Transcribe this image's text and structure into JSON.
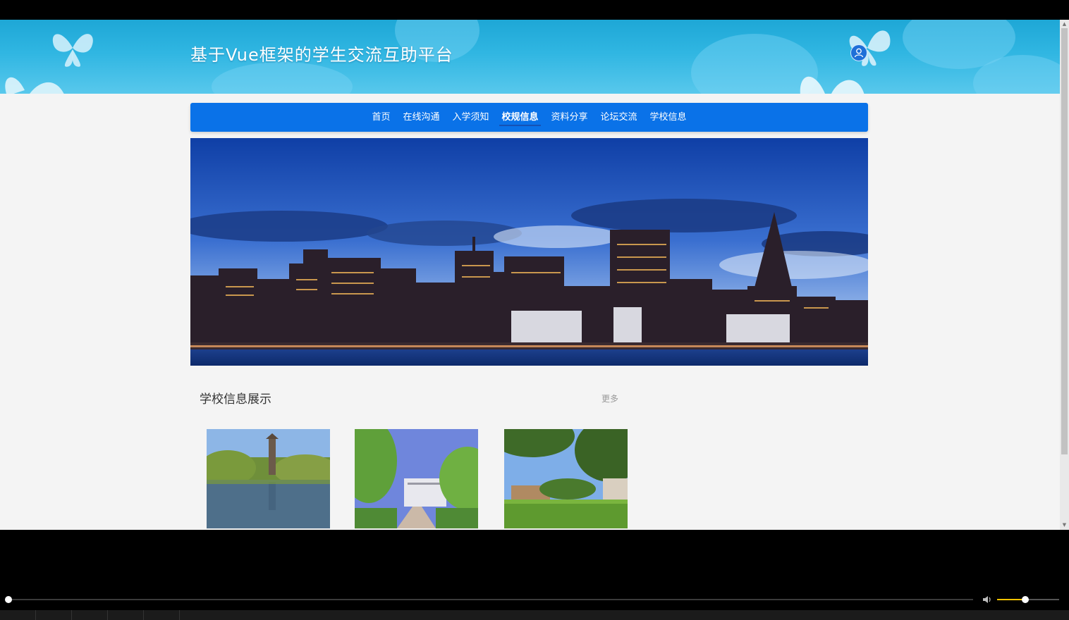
{
  "header": {
    "site_title": "基于Vue框架的学生交流互助平台"
  },
  "nav": {
    "items": [
      {
        "label": "首页"
      },
      {
        "label": "在线沟通"
      },
      {
        "label": "入学须知"
      },
      {
        "label": "校规信息"
      },
      {
        "label": "资料分享"
      },
      {
        "label": "论坛交流"
      },
      {
        "label": "学校信息"
      }
    ],
    "active_index": 3
  },
  "section": {
    "title": "学校信息展示",
    "more_label": "更多"
  },
  "player": {
    "progress": 0.0,
    "volume": 0.45
  },
  "colors": {
    "header_bg": "#30b6e2",
    "nav_bg": "#0a72e8",
    "page_bg": "#f4f4f4",
    "volume_accent": "#f2c200"
  }
}
